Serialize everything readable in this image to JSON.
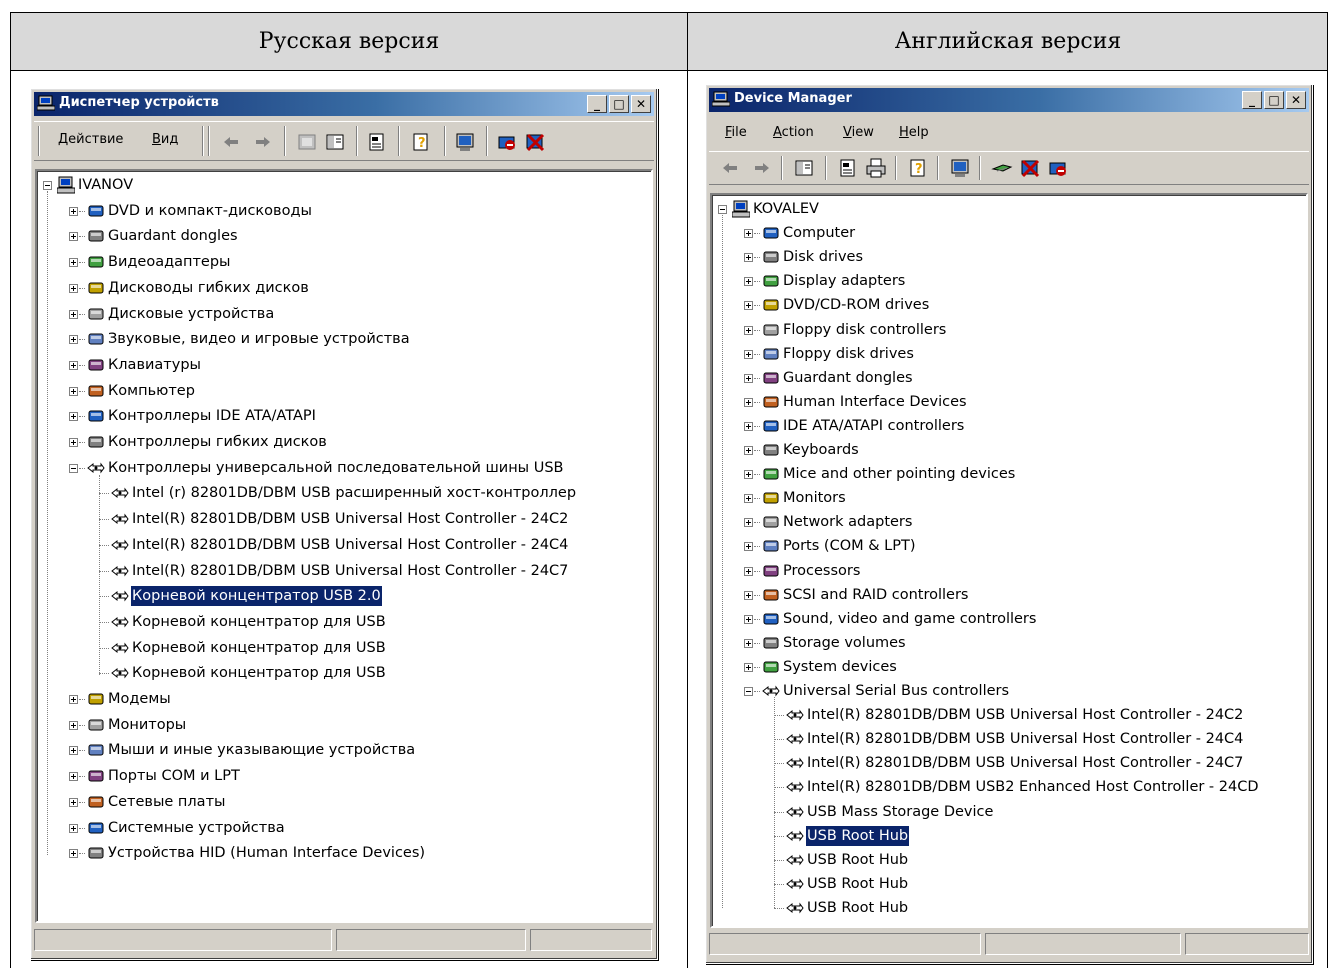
{
  "header": {
    "left": "Русская версия",
    "right": "Английская версия"
  },
  "ru": {
    "title": "Диспетчер устройств",
    "menu": [
      {
        "label": "Действие",
        "ul": "Д"
      },
      {
        "label": "Вид",
        "ul": "В"
      }
    ],
    "root": "IVANOV",
    "categories_top": [
      "DVD и компакт-дисководы",
      "Guardant dongles",
      "Видеоадаптеры",
      "Дисководы гибких дисков",
      "Дисковые устройства",
      "Звуковые, видео и игровые устройства",
      "Клавиатуры",
      "Компьютер",
      "Контроллеры IDE ATA/ATAPI",
      "Контроллеры гибких дисков"
    ],
    "expanded": "Контроллеры универсальной последовательной шины USB",
    "usb_children": [
      "Intel (r) 82801DB/DBM USB расширенный хост-контроллер",
      "Intel(R) 82801DB/DBM USB Universal Host Controller - 24C2",
      "Intel(R) 82801DB/DBM USB Universal Host Controller - 24C4",
      "Intel(R) 82801DB/DBM USB Universal Host Controller - 24C7",
      "Корневой концентратор USB 2.0",
      "Корневой концентратор для USB",
      "Корневой концентратор для USB",
      "Корневой концентратор для USB"
    ],
    "selected_index": 4,
    "categories_bottom": [
      "Модемы",
      "Мониторы",
      "Мыши и иные указывающие устройства",
      "Порты COM и LPT",
      "Сетевые платы",
      "Системные устройства",
      "Устройства HID (Human Interface Devices)"
    ]
  },
  "en": {
    "title": "Device Manager",
    "menu": [
      {
        "label": "File",
        "ul": "F"
      },
      {
        "label": "Action",
        "ul": "A"
      },
      {
        "label": "View",
        "ul": "V"
      },
      {
        "label": "Help",
        "ul": "H"
      }
    ],
    "root": "KOVALEV",
    "categories_top": [
      "Computer",
      "Disk drives",
      "Display adapters",
      "DVD/CD-ROM drives",
      "Floppy disk controllers",
      "Floppy disk drives",
      "Guardant dongles",
      "Human Interface Devices",
      "IDE ATA/ATAPI controllers",
      "Keyboards",
      "Mice and other pointing devices",
      "Monitors",
      "Network adapters",
      "Ports (COM & LPT)",
      "Processors",
      "SCSI and RAID controllers",
      "Sound, video and game controllers",
      "Storage volumes",
      "System devices"
    ],
    "expanded": "Universal Serial Bus controllers",
    "usb_children": [
      "Intel(R) 82801DB/DBM USB Universal Host Controller - 24C2",
      "Intel(R) 82801DB/DBM USB Universal Host Controller - 24C4",
      "Intel(R) 82801DB/DBM USB Universal Host Controller - 24C7",
      "Intel(R) 82801DB/DBM USB2 Enhanced Host Controller - 24CD",
      "USB Mass Storage Device",
      "USB Root Hub",
      "USB Root Hub",
      "USB Root Hub",
      "USB Root Hub"
    ],
    "selected_index": 5,
    "categories_bottom": []
  },
  "colors": {
    "title_start": "#0a246a",
    "title_end": "#a6caf0",
    "face": "#d4d0c8",
    "selection": "#0a246a"
  }
}
